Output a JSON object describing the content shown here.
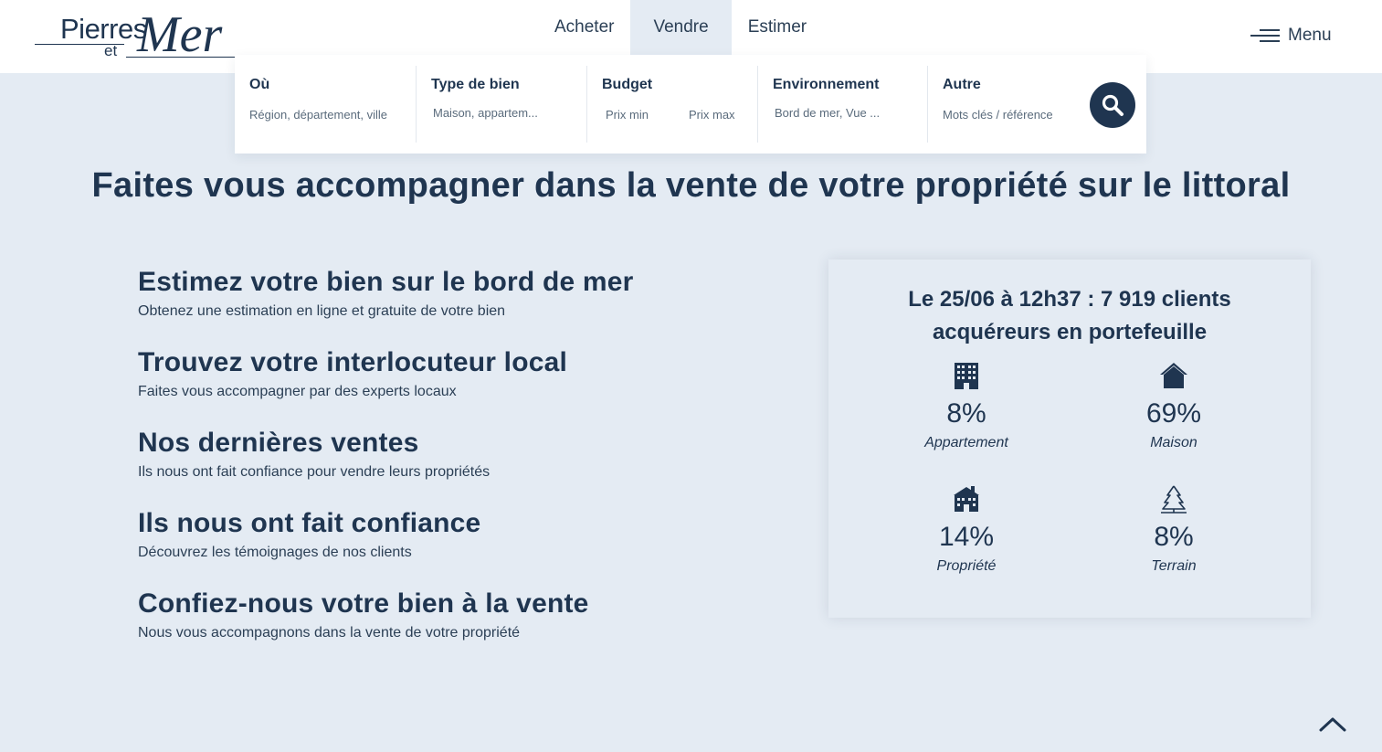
{
  "logo": {
    "brand": "Pierres",
    "et": "et",
    "mer": "Mer"
  },
  "nav": {
    "tabs": [
      {
        "label": "Acheter",
        "active": false
      },
      {
        "label": "Vendre",
        "active": true
      },
      {
        "label": "Estimer",
        "active": false
      }
    ]
  },
  "menu": {
    "label": "Menu",
    "icon": "hamburger-icon"
  },
  "search": {
    "fields": [
      {
        "label": "Où",
        "placeholder": "Région, département, ville"
      },
      {
        "label": "Type de bien",
        "placeholder": "Maison, appartem..."
      },
      {
        "label": "Budget",
        "min_placeholder": "Prix min",
        "max_placeholder": "Prix max"
      },
      {
        "label": "Environnement",
        "placeholder": "Bord de mer, Vue ..."
      },
      {
        "label": "Autre",
        "placeholder": "Mots clés / référence"
      }
    ],
    "button_icon": "search-icon"
  },
  "hero": {
    "title": "Faites vous accompagner dans la vente de votre propriété sur le littoral"
  },
  "links": [
    {
      "title": "Estimez votre bien sur le bord de mer",
      "subtitle": "Obtenez une estimation en ligne et gratuite de votre bien"
    },
    {
      "title": "Trouvez votre interlocuteur local",
      "subtitle": "Faites vous accompagner par des experts locaux"
    },
    {
      "title": "Nos dernières ventes",
      "subtitle": "Ils nous ont fait confiance pour vendre leurs propriétés"
    },
    {
      "title": "Ils nous ont fait confiance",
      "subtitle": "Découvrez les témoignages de nos clients"
    },
    {
      "title": "Confiez-nous votre bien à la vente",
      "subtitle": "Nous vous accompagnons dans la vente de votre propriété"
    }
  ],
  "stats": {
    "heading_line1": "Le 25/06 à 12h37 : 7 919 clients",
    "heading_line2": "acquéreurs en portefeuille",
    "items": [
      {
        "icon": "apartment-building-icon",
        "percent": "8%",
        "label": "Appartement"
      },
      {
        "icon": "house-icon",
        "percent": "69%",
        "label": "Maison"
      },
      {
        "icon": "estate-property-icon",
        "percent": "14%",
        "label": "Propriété"
      },
      {
        "icon": "tree-land-icon",
        "percent": "8%",
        "label": "Terrain"
      }
    ]
  },
  "colors": {
    "navy": "#1f3550",
    "background": "#e4ebf3",
    "white": "#ffffff"
  }
}
